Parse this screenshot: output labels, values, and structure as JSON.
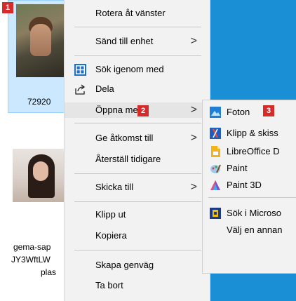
{
  "badges": {
    "one": "1",
    "two": "2",
    "three": "3"
  },
  "files": [
    {
      "name_lines": [
        "72920"
      ]
    },
    {
      "name_lines": [
        "gema-sap",
        "JY3WftLW",
        "plas"
      ]
    }
  ],
  "context_menu": {
    "items": [
      {
        "label": "Rotera åt vänster"
      },
      {
        "label": "Sänd till enhet",
        "arrow": ">"
      },
      {
        "label": "Sök igenom med",
        "icon": "defender-shield-icon"
      },
      {
        "label": "Dela",
        "icon": "share-icon"
      },
      {
        "label": "Öppna med",
        "arrow": ">"
      },
      {
        "label": "Ge åtkomst till",
        "arrow": ">"
      },
      {
        "label": "Återställ tidigare"
      },
      {
        "label": "Skicka till",
        "arrow": ">"
      },
      {
        "label": "Klipp ut"
      },
      {
        "label": "Kopiera"
      },
      {
        "label": "Skapa genväg"
      },
      {
        "label": "Ta bort"
      }
    ]
  },
  "open_with_submenu": {
    "items": [
      {
        "label": "Foton",
        "icon": "photos-app-icon"
      },
      {
        "label": "Klipp & skiss",
        "icon": "snip-sketch-icon"
      },
      {
        "label": "LibreOffice D",
        "icon": "libreoffice-icon"
      },
      {
        "label": "Paint",
        "icon": "paint-icon"
      },
      {
        "label": "Paint 3D",
        "icon": "paint3d-icon"
      },
      {
        "label": "Sök i Microso",
        "icon": "store-icon"
      },
      {
        "label": "Välj en annan"
      }
    ]
  },
  "colors": {
    "badge": "#d62b2b",
    "selection": "#cce8ff",
    "desktop": "#1b8fd6",
    "menu_bg": "#f2f2f2"
  }
}
